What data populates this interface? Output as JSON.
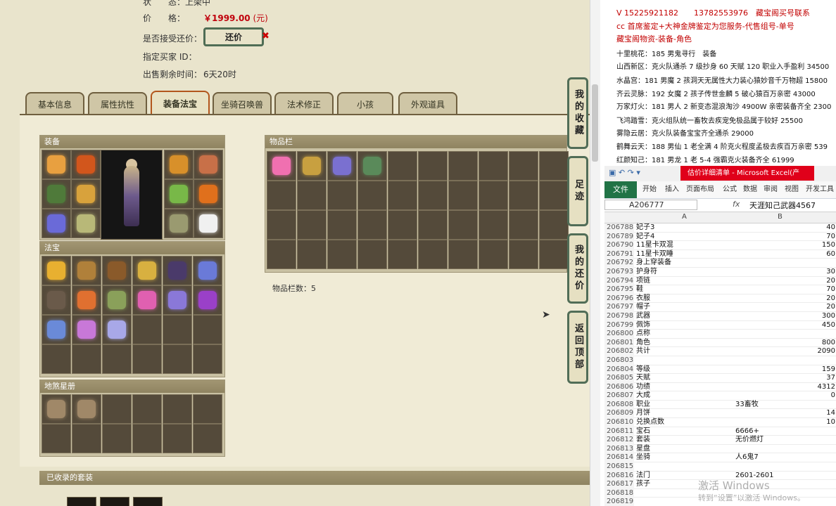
{
  "info": {
    "seller_partial": "状　　态：上架中",
    "price_label": "价　　格：",
    "price_value": "￥1999.00",
    "price_unit": "(元)",
    "accept_haggle_label": "是否接受还价：",
    "haggle_button": "还价",
    "buyer_label": "指定买家 ID：",
    "time_label": "出售剩余时间：",
    "time_value": "6天20时"
  },
  "tabs": [
    {
      "label": "基本信息"
    },
    {
      "label": "属性抗性"
    },
    {
      "label": "装备法宝"
    },
    {
      "label": "坐骑召唤兽"
    },
    {
      "label": "法术修正"
    },
    {
      "label": "小孩"
    },
    {
      "label": "外观道具"
    }
  ],
  "sections": {
    "equipment": "装备",
    "treasures": "法宝",
    "inventory": "物品栏",
    "star_register": "地煞星册",
    "inventory_count": "物品栏数：5",
    "collected_suits": "已收录的套装"
  },
  "side_buttons": {
    "favorites": "我的收藏",
    "footprints": "足迹",
    "my_haggles": "我的还价",
    "back_to_top": "返回顶部"
  },
  "colors": {
    "price": "#c0000c",
    "excel_green": "#217346",
    "title_red": "#e0001a"
  },
  "ads": {
    "line1": "V 15225921182　　13782553976　藏宝阁买号联系",
    "line2": "cc 首席鉴定+大神金牌鉴定为您服务-代售组号-单号",
    "line3": "藏宝阁物资-装备-角色"
  },
  "listings": [
    "十里桃花：185 男鬼寻行　装备　",
    "山西新区：克火队通杀 7 级抄身 60 天赋 120 职业入手盈利 34500",
    "水晶宫：181 男魔 2 孩洞天无属性大力装心猿妙音千万物超 15800",
    "齐云灵脉：192 女魔 2 孩子传世金麟 5 破心猿百万亲密 43000",
    "万家灯火：181 男人 2 新变态混浪淘沙 4900W 亲密装备齐全 2300",
    "飞鸿踏雪：克火组队统一畜牧去疾宠免极品属于较好 25500",
    "雾隐云居：克火队装备宝宝齐全通杀 29000",
    "鹤舞云天：188 男仙 1 老全满 4 阶克火程度孟极去疾百万亲密 539",
    "红颜知己：181 男龙 1 老 5-4 强霸克火装备齐全 61999"
  ],
  "excel": {
    "title": "估价详细清单 - Microsoft Excel(产",
    "ribbon_tabs": [
      "文件",
      "开始",
      "插入",
      "页面布局",
      "公式",
      "数据",
      "审阅",
      "视图",
      "开发工具"
    ],
    "name_box": "A206777",
    "formula_symbol": "fx",
    "formula_value": "天涯知己武器4567",
    "col_a": "A",
    "col_b": "B",
    "rows": [
      {
        "n": "206788",
        "a": "妃子3",
        "b": "40"
      },
      {
        "n": "206789",
        "a": "妃子4",
        "b": "70"
      },
      {
        "n": "206790",
        "a": "11星卡双混",
        "b": "150"
      },
      {
        "n": "206791",
        "a": "11星卡双睡",
        "b": "60"
      },
      {
        "n": "206792",
        "a": "身上穿装备",
        "b": ""
      },
      {
        "n": "206793",
        "a": "护身符",
        "b": "30"
      },
      {
        "n": "206794",
        "a": "项链",
        "b": "20"
      },
      {
        "n": "206795",
        "a": "鞋",
        "b": "70"
      },
      {
        "n": "206796",
        "a": "衣服",
        "b": "20"
      },
      {
        "n": "206797",
        "a": "帽子",
        "b": "20"
      },
      {
        "n": "206798",
        "a": "武器",
        "b": "300"
      },
      {
        "n": "206799",
        "a": "佩饰",
        "b": "450"
      },
      {
        "n": "206800",
        "a": "点称",
        "b": ""
      },
      {
        "n": "206801",
        "a": "角色",
        "b": "800"
      },
      {
        "n": "206802",
        "a": "共计",
        "b": "2090"
      },
      {
        "n": "206803",
        "a": "",
        "b": ""
      },
      {
        "n": "206804",
        "a": "等级",
        "b": "159"
      },
      {
        "n": "206805",
        "a": "天赋",
        "b": "37"
      },
      {
        "n": "206806",
        "a": "功绩",
        "b": "4312"
      },
      {
        "n": "206807",
        "a": "大成",
        "b": "0"
      },
      {
        "n": "206808",
        "a": "职业",
        "b": "33畜牧",
        "t": true
      },
      {
        "n": "206809",
        "a": "月饼",
        "b": "14"
      },
      {
        "n": "206810",
        "a": "兑换点数",
        "b": "10"
      },
      {
        "n": "206811",
        "a": "宝石",
        "b": "6666+",
        "t": true
      },
      {
        "n": "206812",
        "a": "套装",
        "b": "无价燃灯",
        "t": true
      },
      {
        "n": "206813",
        "a": "星盘",
        "b": ""
      },
      {
        "n": "206814",
        "a": "坐骑",
        "b": "人6鬼7",
        "t": true
      },
      {
        "n": "206815",
        "a": "",
        "b": ""
      },
      {
        "n": "206816",
        "a": "法门",
        "b": "2601-2601",
        "t": true
      },
      {
        "n": "206817",
        "a": "孩子",
        "b": ""
      },
      {
        "n": "206818",
        "a": "",
        "b": ""
      },
      {
        "n": "206819",
        "a": "",
        "b": ""
      }
    ]
  },
  "watermark": {
    "line1": "激活 Windows",
    "line2": "转到“设置”以激活 Windows。"
  }
}
